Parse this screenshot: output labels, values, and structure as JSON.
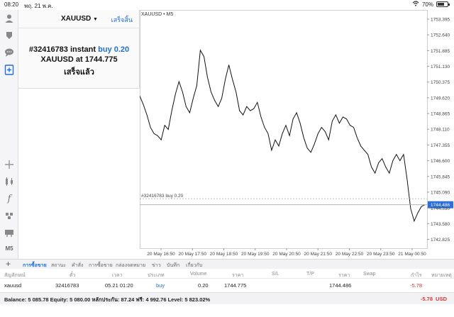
{
  "status_bar": {
    "time": "08:20",
    "date": "พฤ. 21 พ.ค.",
    "battery": "70%"
  },
  "toolbar": {
    "timeframe_label": "M5"
  },
  "order_panel": {
    "symbol": "XAUUSD",
    "done_label": "เสร็จสิ้น",
    "order_prefix": "#32416783 instant",
    "order_action": "buy 0.20",
    "fill_text": "XAUUSD at 1744.775",
    "result": "เสร็จแล้ว"
  },
  "chart": {
    "header": "XAUUSD • M5",
    "order_line_label": "#32416783 buy 0.20",
    "current_price_label": "1744.486",
    "price_ticks": [
      "1753.395",
      "1752.640",
      "1751.885",
      "1751.130",
      "1750.375",
      "1749.620",
      "1748.865",
      "1748.110",
      "1747.355",
      "1746.600",
      "1745.845",
      "1745.090",
      "1744.330",
      "1743.580",
      "1742.825"
    ],
    "time_ticks": [
      "20 May 16:50",
      "20 May 17:50",
      "20 May 18:50",
      "20 May 19:50",
      "20 May 20:50",
      "20 May 21:50",
      "20 May 22:50",
      "20 May 23:50",
      "21 May 00:50"
    ]
  },
  "chart_data": {
    "type": "line",
    "ylim": [
      1742.4,
      1753.7
    ],
    "order_price": 1744.775,
    "current_price": 1744.486,
    "values": [
      1749.7,
      1749.3,
      1748.8,
      1748.2,
      1747.9,
      1747.8,
      1747.6,
      1748.3,
      1748.1,
      1749.0,
      1749.8,
      1750.4,
      1749.9,
      1749.2,
      1748.9,
      1749.6,
      1750.2,
      1751.9,
      1751.6,
      1750.6,
      1749.9,
      1749.5,
      1749.2,
      1749.6,
      1750.5,
      1751.2,
      1750.5,
      1749.9,
      1749.0,
      1748.8,
      1749.2,
      1749.0,
      1749.1,
      1749.4,
      1748.7,
      1748.2,
      1747.9,
      1747.1,
      1747.6,
      1747.3,
      1747.9,
      1748.3,
      1747.8,
      1748.6,
      1748.9,
      1748.4,
      1747.7,
      1747.2,
      1747.0,
      1747.4,
      1747.9,
      1748.2,
      1748.0,
      1747.6,
      1748.5,
      1748.8,
      1748.4,
      1748.7,
      1748.6,
      1748.3,
      1748.2,
      1747.7,
      1747.3,
      1747.1,
      1746.9,
      1746.3,
      1746.0,
      1746.5,
      1746.7,
      1746.3,
      1746.0,
      1746.6,
      1746.9,
      1746.6,
      1746.9,
      1745.7,
      1744.3,
      1743.7,
      1744.1,
      1744.4,
      1744.49
    ]
  },
  "bottom_tabs": [
    "การซื้อขาย",
    "สถานะ",
    "คำสั่ง",
    "การซื้อขาย",
    "กล่องจดหมาย",
    "ข่าว",
    "บันทึก",
    "เกี่ยวกับ"
  ],
  "table": {
    "headers": [
      "สัญลักษณ์",
      "ตั๋ว",
      "เวลา",
      "ประเภท",
      "Volume",
      "ราคา",
      "S/L",
      "T/P",
      "ราคา",
      "Swap",
      "กำไร",
      "หมายเหตุ"
    ],
    "row": {
      "symbol": "xauusd",
      "ticket": "32416783",
      "time": "05.21 01:20",
      "type": "buy",
      "volume": "0.20",
      "open_price": "1744.775",
      "sl": "",
      "tp": "",
      "current_price": "1744.486",
      "swap": "",
      "profit": "-5.78",
      "comment": ""
    }
  },
  "balance": {
    "text": "Balance: 5 085.78 Equity: 5 080.00 หลักประกัน: 87.24 ฟรี: 4 992.76 Level: 5 823.02%",
    "total": "-5.78",
    "currency": "USD"
  },
  "colors": {
    "accent": "#1e6fd9",
    "loss": "#e03333",
    "price_tag": "#2a6fdb"
  }
}
